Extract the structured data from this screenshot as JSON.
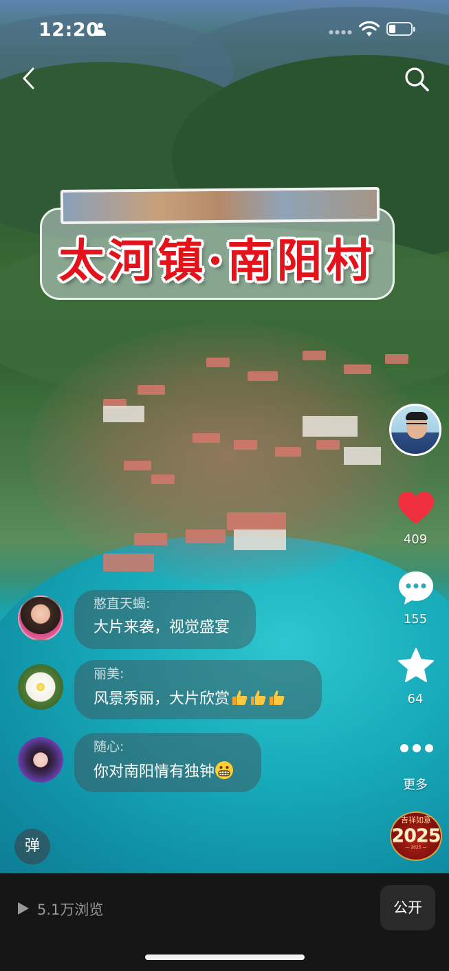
{
  "status_bar": {
    "time": "12:20",
    "battery_level": 0.3
  },
  "video": {
    "title_overlay": "太河镇·南阳村"
  },
  "right_rail": {
    "likes": "409",
    "comments": "155",
    "favorites": "64",
    "more_label": "更多",
    "badge_top": "吉祥如意",
    "badge_year": "2025",
    "badge_bottom": "— 2025 —"
  },
  "danmaku": [
    {
      "name": "憨直天蝎:",
      "message": "大片来袭，视觉盛宴"
    },
    {
      "name": "丽美:",
      "message": "风景秀丽，大片欣赏"
    },
    {
      "name": "随心:",
      "message": "你对南阳情有独钟"
    }
  ],
  "danmaku_toggle": "弹",
  "bottom_bar": {
    "views": "5.1万浏览",
    "visibility_button": "公开"
  },
  "colors": {
    "like_red": "#f0303f",
    "title_red": "#e4121b",
    "bottom_bg": "#161616"
  }
}
